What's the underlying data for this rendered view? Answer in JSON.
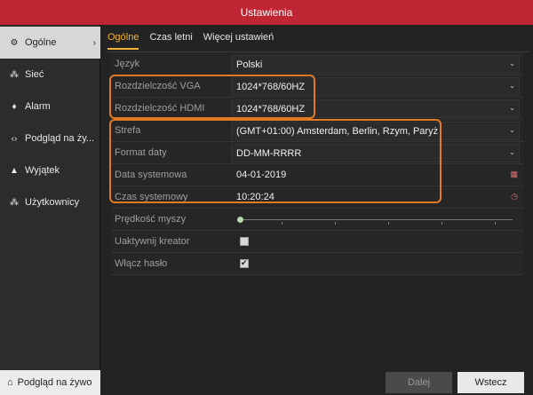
{
  "window": {
    "title": "Ustawienia"
  },
  "sidebar": {
    "items": [
      {
        "label": "Ogólne",
        "icon": "gear-icon",
        "glyph": "⚙",
        "active": true
      },
      {
        "label": "Sieć",
        "icon": "network-icon",
        "glyph": "⁂",
        "active": false
      },
      {
        "label": "Alarm",
        "icon": "alarm-icon",
        "glyph": "♦",
        "active": false
      },
      {
        "label": "Podgląd na ży...",
        "icon": "preview-icon",
        "glyph": "‹›",
        "active": false
      },
      {
        "label": "Wyjątek",
        "icon": "warning-icon",
        "glyph": "▲",
        "active": false
      },
      {
        "label": "Użytkownicy",
        "icon": "users-icon",
        "glyph": "⁂",
        "active": false
      }
    ],
    "bottom": {
      "label": "Podgląd na żywo",
      "icon": "home-icon",
      "glyph": "⌂"
    }
  },
  "tabs": [
    {
      "label": "Ogólne",
      "active": true
    },
    {
      "label": "Czas letni",
      "active": false
    },
    {
      "label": "Więcej ustawień",
      "active": false
    }
  ],
  "settings": {
    "language": {
      "label": "Język",
      "value": "Polski"
    },
    "vga_resolution": {
      "label": "Rozdzielczość VGA",
      "value": "1024*768/60HZ"
    },
    "hdmi_resolution": {
      "label": "Rozdzielczość HDMI",
      "value": "1024*768/60HZ"
    },
    "timezone": {
      "label": "Strefa",
      "value": "(GMT+01:00) Amsterdam, Berlin, Rzym, Paryż"
    },
    "date_format": {
      "label": "Format daty",
      "value": "DD-MM-RRRR"
    },
    "system_date": {
      "label": "Data systemowa",
      "value": "04-01-2019"
    },
    "system_time": {
      "label": "Czas systemowy",
      "value": "10:20:24"
    },
    "mouse_speed": {
      "label": "Prędkość myszy",
      "level": 0.0
    },
    "wizard": {
      "label": "Uaktywnij kreator",
      "checked": false
    },
    "password": {
      "label": "Włącz hasło",
      "checked": true
    }
  },
  "buttons": {
    "next": "Dalej",
    "back": "Wstecz"
  },
  "colors": {
    "title_bar": "#bf2533",
    "accent": "#f2b233",
    "highlight": "#e27a22"
  }
}
